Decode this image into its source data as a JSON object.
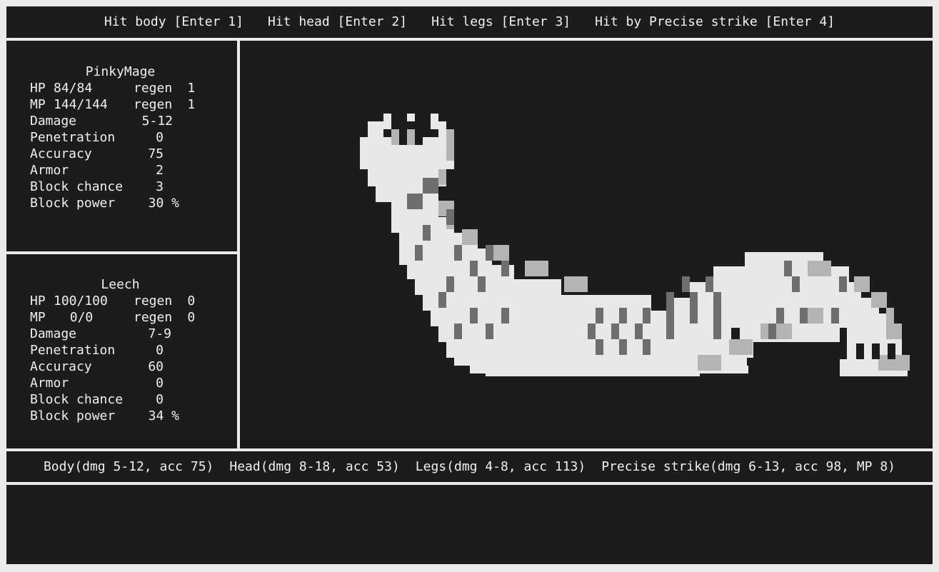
{
  "commands": [
    "Hit body [Enter 1]",
    "Hit head [Enter 2]",
    "Hit legs [Enter 3]",
    "Hit by Precise strike [Enter 4]"
  ],
  "player": {
    "name": "PinkyMage",
    "hp_label": "HP",
    "hp": "84/84",
    "hp_regen_label": "regen",
    "hp_regen": "1",
    "mp_label": "MP",
    "mp": "144/144",
    "mp_regen_label": "regen",
    "mp_regen": "1",
    "stats": [
      {
        "label": "Damage",
        "value": "5-12"
      },
      {
        "label": "Penetration",
        "value": "0"
      },
      {
        "label": "Accuracy",
        "value": "75"
      },
      {
        "label": "Armor",
        "value": "2"
      },
      {
        "label": "Block chance",
        "value": "3"
      },
      {
        "label": "Block power",
        "value": "30 %"
      }
    ]
  },
  "enemy": {
    "name": "Leech",
    "hp_label": "HP",
    "hp": "100/100",
    "hp_regen_label": "regen",
    "hp_regen": "0",
    "mp_label": "MP",
    "mp": "0/0",
    "mp_regen_label": "regen",
    "mp_regen": "0",
    "stats": [
      {
        "label": "Damage",
        "value": "7-9"
      },
      {
        "label": "Penetration",
        "value": "0"
      },
      {
        "label": "Accuracy",
        "value": "60"
      },
      {
        "label": "Armor",
        "value": "0"
      },
      {
        "label": "Block chance",
        "value": "0"
      },
      {
        "label": "Block power",
        "value": "34 %"
      }
    ]
  },
  "attacks": [
    "Body(dmg 5-12, acc 75)",
    "Head(dmg 8-18, acc 53)",
    "Legs(dmg 4-8, acc 113)",
    "Precise strike(dmg 6-13, acc 98, MP 8)"
  ],
  "sprite": {
    "name": "leech-sprite",
    "colors": {
      "background": "#1c1c1c",
      "body": "#e8e8e8",
      "shade": "#b4b4b4",
      "dark": "#6e6e6e"
    }
  }
}
